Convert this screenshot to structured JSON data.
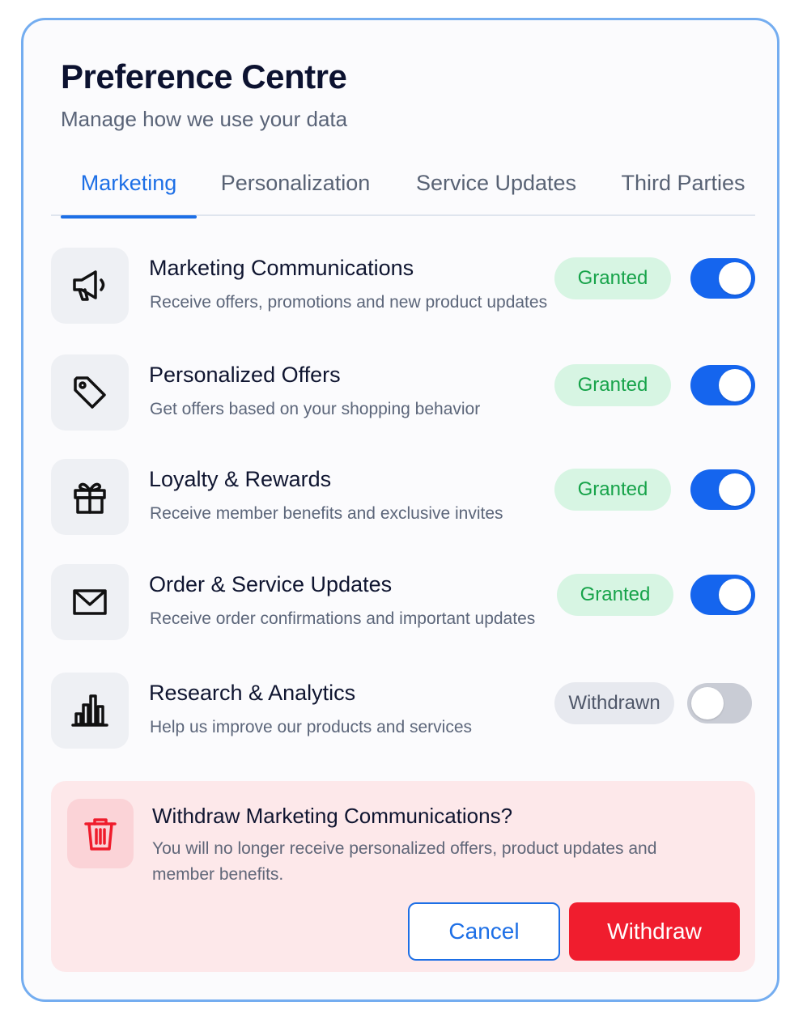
{
  "header": {
    "title": "Preference Centre",
    "subtitle": "Manage how we use your data"
  },
  "tabs": [
    {
      "label": "Marketing",
      "active": true
    },
    {
      "label": "Personalization",
      "active": false
    },
    {
      "label": "Service Updates",
      "active": false
    },
    {
      "label": "Third Parties",
      "active": false
    }
  ],
  "preferences": [
    {
      "icon": "megaphone-icon",
      "title": "Marketing Communications",
      "description": "Receive offers, promotions and new product updates",
      "status": "Granted",
      "enabled": true
    },
    {
      "icon": "tag-icon",
      "title": "Personalized Offers",
      "description": "Get offers based on your shopping behavior",
      "status": "Granted",
      "enabled": true
    },
    {
      "icon": "gift-icon",
      "title": "Loyalty & Rewards",
      "description": "Receive member benefits and exclusive invites",
      "status": "Granted",
      "enabled": true
    },
    {
      "icon": "mail-icon",
      "title": "Order & Service Updates",
      "description": "Receive order confirmations and important updates",
      "status": "Granted",
      "enabled": true
    },
    {
      "icon": "bar-chart-icon",
      "title": "Research & Analytics",
      "description": "Help us improve our products and services",
      "status": "Withdrawn",
      "enabled": false
    }
  ],
  "confirm": {
    "icon": "trash-icon",
    "title": "Withdraw Marketing Communications?",
    "description": "You will no longer receive personalized offers, product updates and member benefits.",
    "cancel_label": "Cancel",
    "withdraw_label": "Withdraw"
  },
  "colors": {
    "accent": "#1d6fe6",
    "toggle_on": "#1565ee",
    "granted_text": "#17a34a",
    "granted_bg": "#d7f5e3",
    "danger": "#f01d2e",
    "danger_bg": "#fde8ea",
    "card_border": "#74adf0"
  }
}
